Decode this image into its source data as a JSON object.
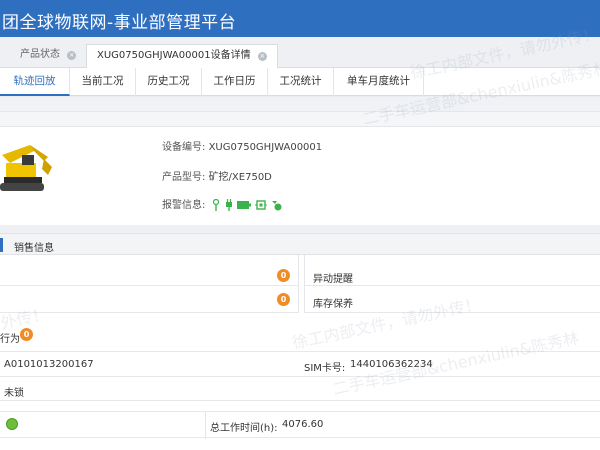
{
  "header": {
    "title": "团全球物联网-事业部管理平台"
  },
  "page_tabs": [
    {
      "label": "产品状态",
      "close_glyph": "×"
    },
    {
      "label": "XUG0750GHJWA00001设备详情",
      "close_glyph": "×"
    }
  ],
  "sub_tabs": [
    {
      "label": "轨迹回放"
    },
    {
      "label": "当前工况"
    },
    {
      "label": "历史工况"
    },
    {
      "label": "工作日历"
    },
    {
      "label": "工况统计"
    },
    {
      "label": "单车月度统计"
    }
  ],
  "device": {
    "serial_label": "设备编号:",
    "serial_value": "XUG0750GHJWA00001",
    "model_label": "产品型号:",
    "model_value": "矿挖/XE750D",
    "alarm_label": "报警信息:",
    "alarm_icons": [
      "antenna-icon",
      "plug-icon",
      "battery-icon",
      "gps-icon",
      "signal-icon"
    ]
  },
  "sales": {
    "section_title": "销售信息",
    "abnormal_count": "0",
    "abnormal_label": "异动提醒",
    "stock_count": "0",
    "stock_label": "库存保养",
    "behavior_label": "行为",
    "behavior_count": "0",
    "terminal_id": "A0101013200167",
    "sim_label": "SIM卡号:",
    "sim_value": "1440106362234",
    "lock_status": "未锁",
    "total_hours_label": "总工作时间(h):",
    "total_hours_value": "4076.60"
  },
  "watermarks": [
    "徐工内部文件，请勿外传！",
    "二手车运营部&chenxiulin&陈秀林",
    "外传！"
  ],
  "colors": {
    "brand": "#2f6fc0",
    "badge": "#f08c28",
    "alarm_green": "#3bb34a"
  }
}
